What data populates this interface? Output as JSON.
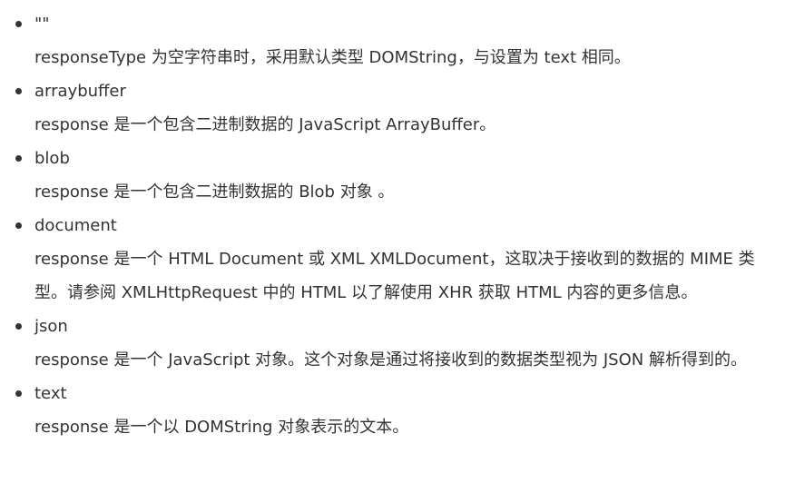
{
  "items": [
    {
      "term": "\"\"",
      "description": "responseType 为空字符串时，采用默认类型 DOMString，与设置为 text 相同。"
    },
    {
      "term": "arraybuffer",
      "description": "response 是一个包含二进制数据的 JavaScript ArrayBuffer。"
    },
    {
      "term": "blob",
      "description": "response 是一个包含二进制数据的 Blob 对象 。"
    },
    {
      "term": "document",
      "description": "response 是一个 HTML Document 或 XML XMLDocument，这取决于接收到的数据的 MIME 类型。请参阅 XMLHttpRequest 中的 HTML 以了解使用 XHR 获取 HTML 内容的更多信息。"
    },
    {
      "term": "json",
      "description": "response 是一个 JavaScript 对象。这个对象是通过将接收到的数据类型视为 JSON 解析得到的。"
    },
    {
      "term": "text",
      "description": "response 是一个以 DOMString 对象表示的文本。"
    }
  ]
}
